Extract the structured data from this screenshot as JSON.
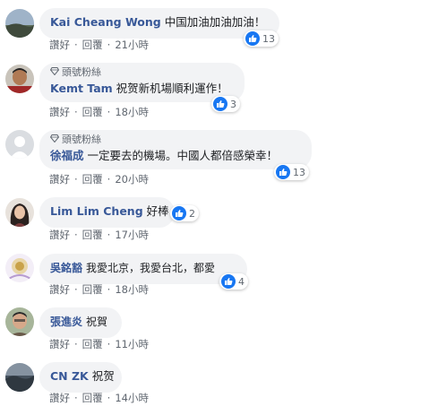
{
  "comments": [
    {
      "author": "Kai Cheang Wong",
      "text": "中国加油加油加油！",
      "reactions": "13",
      "like": "讚好",
      "reply": "回覆",
      "time": "21小時"
    },
    {
      "fan_badge": "頭號粉絲",
      "author": "Kemt Tam",
      "text": "祝贺新机場順利運作！",
      "reactions": "3",
      "like": "讚好",
      "reply": "回覆",
      "time": "18小時"
    },
    {
      "fan_badge": "頭號粉絲",
      "author": "徐福成",
      "text": "一定要去的機場。中國人都倍感榮幸！",
      "reactions": "13",
      "like": "讚好",
      "reply": "回覆",
      "time": "20小時"
    },
    {
      "author": "Lim Lim Cheng",
      "text": "好棒",
      "reactions": "2",
      "like": "讚好",
      "reply": "回覆",
      "time": "17小時"
    },
    {
      "author": "吳銘豁",
      "text": "我愛北京，我愛台北，都愛",
      "reactions": "4",
      "like": "讚好",
      "reply": "回覆",
      "time": "18小時"
    },
    {
      "author": "張進炎",
      "text": "祝賀",
      "like": "讚好",
      "reply": "回覆",
      "time": "11小時"
    },
    {
      "author": "CN ZK",
      "text": "祝贺",
      "like": "讚好",
      "reply": "回覆",
      "time": "14小時"
    }
  ],
  "colors": {
    "author": "#385898",
    "bubble": "#f2f3f5",
    "like_blue": "#1877f2",
    "meta": "#606770"
  },
  "icons": {
    "fan_badge": "diamond-icon",
    "reaction": "thumbs-up-icon"
  }
}
